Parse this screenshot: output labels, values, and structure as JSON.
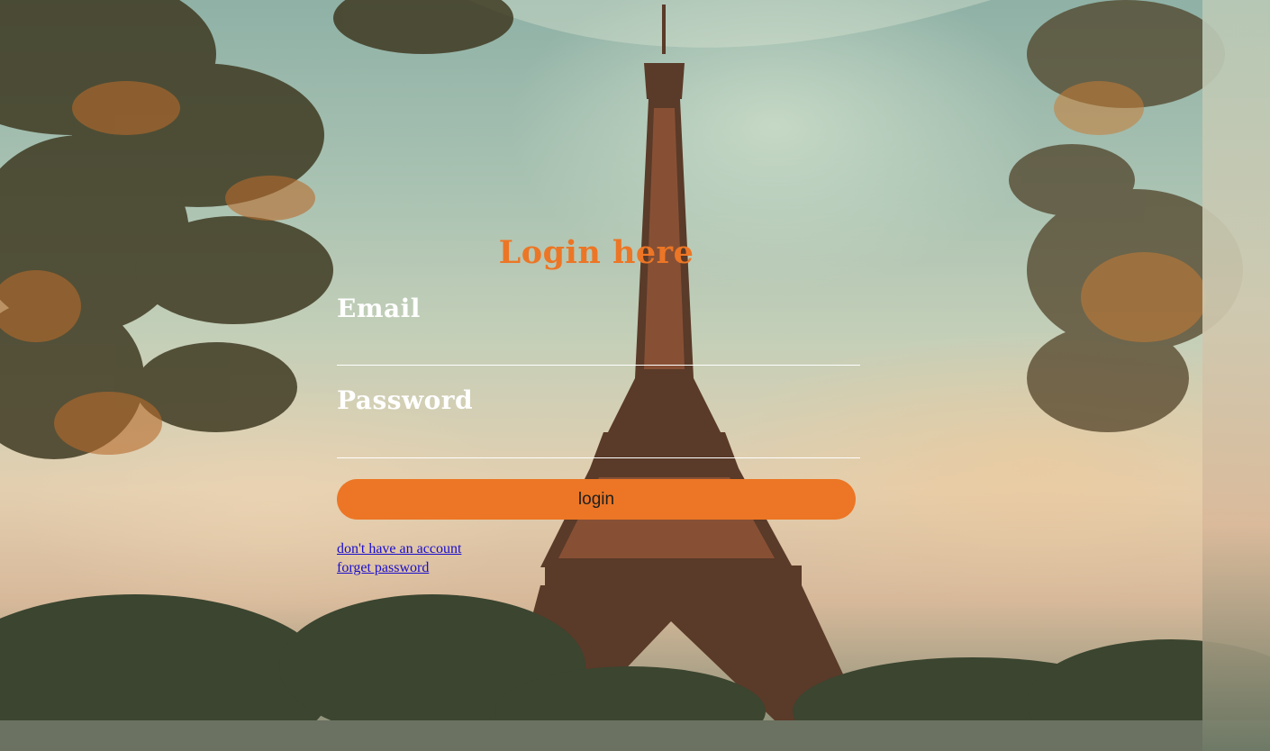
{
  "page": {
    "title": "Login here"
  },
  "form": {
    "email_label": "Email",
    "email_value": "",
    "password_label": "Password",
    "password_value": "",
    "login_button": "login",
    "no_account_link": "don't have an account",
    "forget_password_link": "forget password"
  },
  "colors": {
    "accent": "#ec7625",
    "label": "#ffffff",
    "link": "#1a0dcc"
  },
  "background": {
    "icon": "eiffel-tower-photo"
  }
}
